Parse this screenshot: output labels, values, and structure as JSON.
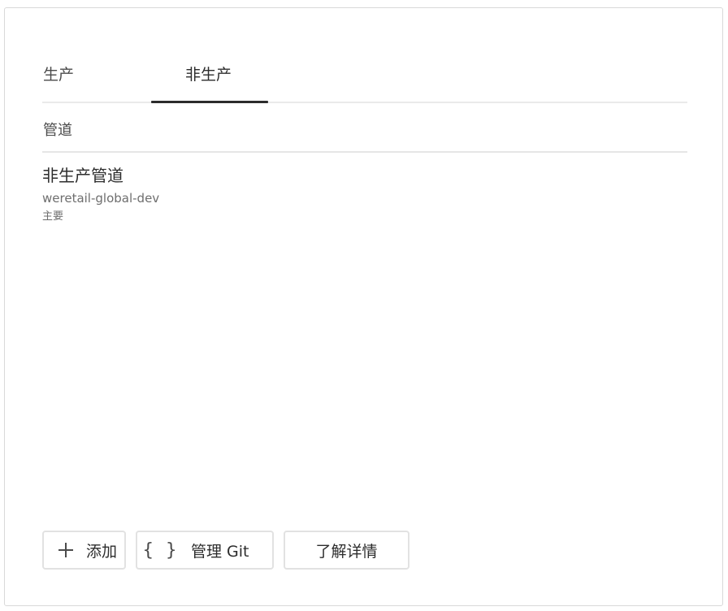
{
  "tabs": [
    {
      "label": "生产",
      "active": false
    },
    {
      "label": "非生产",
      "active": true
    }
  ],
  "section": {
    "header": "管道"
  },
  "pipeline": {
    "name": "非生产管道",
    "repository": "weretail-global-dev",
    "branch": "主要"
  },
  "actions": {
    "add_label": "添加",
    "add_icon": "plus-icon",
    "git_label": "管理 Git",
    "git_icon": "braces-icon",
    "learn_label": "了解详情"
  },
  "colors": {
    "text": "#2c2c2c",
    "muted": "#6e6e6e",
    "border": "#e2e2e2",
    "active_tab_underline": "#2c2c2c"
  }
}
